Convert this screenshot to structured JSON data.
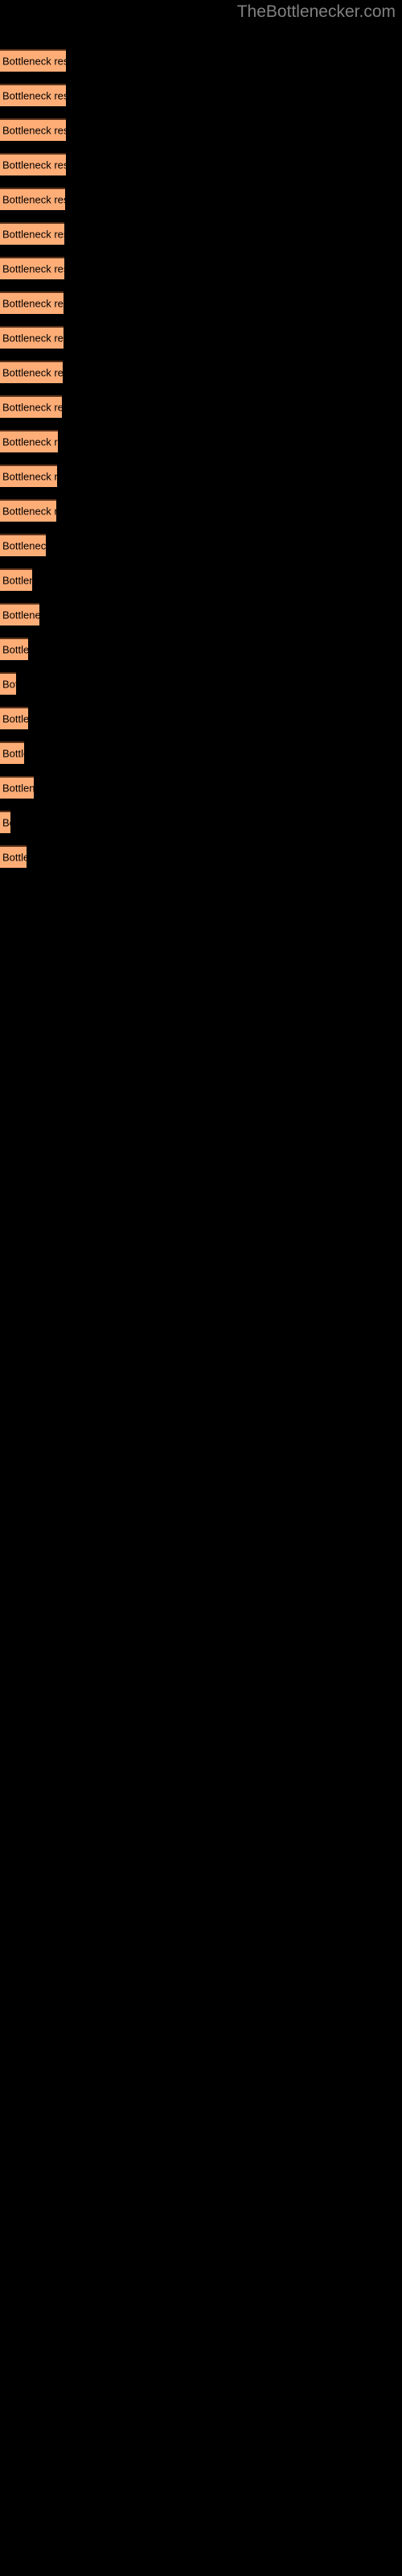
{
  "header": {
    "site_title": "TheBottlenecker.com",
    "title_color": "#808080"
  },
  "colors": {
    "background": "#000000",
    "bar_fill": "#ffad77",
    "bar_border_top": "#5a3219",
    "bar_label_text": "#000000"
  },
  "chart_data": {
    "type": "bar",
    "orientation": "horizontal",
    "title": "TheBottlenecker.com",
    "xlabel": "",
    "ylabel": "",
    "grid": false,
    "legend": false,
    "bar_label_text": "Bottleneck result",
    "categories": [
      "Bottleneck result",
      "Bottleneck result",
      "Bottleneck result",
      "Bottleneck result",
      "Bottleneck result",
      "Bottleneck result",
      "Bottleneck result",
      "Bottleneck result",
      "Bottleneck result",
      "Bottleneck result",
      "Bottleneck result",
      "Bottleneck result",
      "Bottleneck result",
      "Bottleneck result",
      "Bottleneck result",
      "Bottleneck result",
      "Bottleneck result",
      "Bottleneck result",
      "Bottleneck result",
      "Bottleneck result",
      "Bottleneck result",
      "Bottleneck result",
      "Bottleneck result"
    ],
    "values": [
      82,
      82,
      82,
      82,
      81,
      80,
      80,
      79,
      79,
      78,
      77,
      72,
      71,
      70,
      57,
      40,
      49,
      42,
      26,
      16,
      42,
      24,
      48,
      13,
      33
    ],
    "xlim": [
      0,
      500
    ]
  },
  "bars": [
    {
      "name": "bar-1",
      "label": "Bottleneck result",
      "y": 61,
      "width": 82,
      "height": 28,
      "visible_text": "Bottleneck result"
    },
    {
      "name": "bar-2",
      "label": "Bottleneck result",
      "y": 104,
      "width": 82,
      "height": 28,
      "visible_text": "Bottleneck result"
    },
    {
      "name": "bar-3",
      "label": "Bottleneck result",
      "y": 147,
      "width": 82,
      "height": 28,
      "visible_text": "Bottleneck result"
    },
    {
      "name": "bar-4",
      "label": "Bottleneck result",
      "y": 190,
      "width": 82,
      "height": 28,
      "visible_text": "Bottleneck result"
    },
    {
      "name": "bar-5",
      "label": "Bottleneck result",
      "y": 233,
      "width": 81,
      "height": 28,
      "visible_text": "Bottleneck result"
    },
    {
      "name": "bar-6",
      "label": "Bottleneck result",
      "y": 276,
      "width": 80,
      "height": 28,
      "visible_text": "Bottleneck result"
    },
    {
      "name": "bar-7",
      "label": "Bottleneck result",
      "y": 319,
      "width": 80,
      "height": 28,
      "visible_text": "Bottleneck result"
    },
    {
      "name": "bar-8",
      "label": "Bottleneck result",
      "y": 362,
      "width": 79,
      "height": 28,
      "visible_text": "Bottleneck result"
    },
    {
      "name": "bar-9",
      "label": "Bottleneck result",
      "y": 405,
      "width": 79,
      "height": 28,
      "visible_text": "Bottleneck result"
    },
    {
      "name": "bar-10",
      "label": "Bottleneck result",
      "y": 448,
      "width": 78,
      "height": 28,
      "visible_text": "Bottleneck result"
    },
    {
      "name": "bar-11",
      "label": "Bottleneck result",
      "y": 491,
      "width": 77,
      "height": 28,
      "visible_text": "Bottleneck result"
    },
    {
      "name": "bar-12",
      "label": "Bottleneck result",
      "y": 534,
      "width": 72,
      "height": 28,
      "visible_text": "Bottleneck result"
    },
    {
      "name": "bar-13",
      "label": "Bottleneck result",
      "y": 577,
      "width": 71,
      "height": 28,
      "visible_text": "Bottleneck result"
    },
    {
      "name": "bar-14",
      "label": "Bottleneck result",
      "y": 620,
      "width": 70,
      "height": 28,
      "visible_text": "Bottleneck result"
    },
    {
      "name": "bar-15",
      "label": "Bottleneck result",
      "y": 663,
      "width": 57,
      "height": 28,
      "visible_text": "Bottleneck re"
    },
    {
      "name": "bar-16",
      "label": "Bottleneck result",
      "y": 706,
      "width": 40,
      "height": 28,
      "visible_text": "Bottlene"
    },
    {
      "name": "bar-17",
      "label": "Bottleneck result",
      "y": 749,
      "width": 49,
      "height": 28,
      "visible_text": "Bottleneck"
    },
    {
      "name": "bar-18",
      "label": "Bottleneck result",
      "y": 792,
      "width": 35,
      "height": 28,
      "visible_text": "Bottle"
    },
    {
      "name": "bar-19",
      "label": "Bottleneck result",
      "y": 835,
      "width": 20,
      "height": 28,
      "visible_text": "Bo"
    },
    {
      "name": "bar-20",
      "label": "Bottleneck result",
      "y": 878,
      "width": 35,
      "height": 28,
      "visible_text": "Bottle"
    },
    {
      "name": "bar-21",
      "label": "Bottleneck result",
      "y": 921,
      "width": 30,
      "height": 28,
      "visible_text": "Bottl"
    },
    {
      "name": "bar-22",
      "label": "Bottleneck result",
      "y": 964,
      "width": 42,
      "height": 28,
      "visible_text": "Bottlene"
    },
    {
      "name": "bar-23",
      "label": "Bottleneck result",
      "y": 1007,
      "width": 13,
      "height": 28,
      "visible_text": "B"
    },
    {
      "name": "bar-24",
      "label": "Bottleneck result",
      "y": 1050,
      "width": 33,
      "height": 28,
      "visible_text": "Bottle"
    }
  ]
}
